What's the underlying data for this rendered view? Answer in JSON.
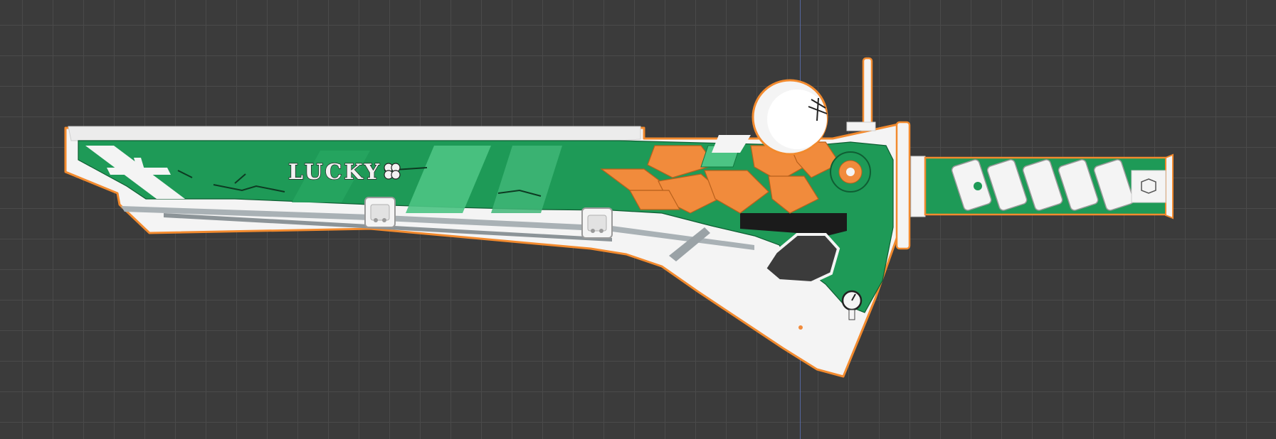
{
  "canvas": {
    "background": "#3b3b3b",
    "grid_color": "#4a4a4a",
    "guide_color": "#5a6fb0"
  },
  "weapon": {
    "inscription": "LUCKY",
    "inscription_icon": "clover-icon",
    "colors": {
      "green": "#1e9a57",
      "green_light": "#4cc484",
      "green_dark": "#137a41",
      "orange": "#f18b3c",
      "white": "#f4f4f4",
      "outline": "#f28a2e",
      "dark": "#1b1b1b"
    }
  }
}
